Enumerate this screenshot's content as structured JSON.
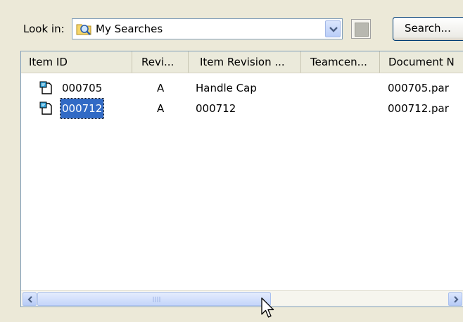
{
  "toolbar": {
    "lookin_label": "Look in:",
    "combo_value": "My Searches",
    "search_label": "Search..."
  },
  "list": {
    "columns": [
      "Item ID",
      "Revi...",
      "Item Revision ...",
      "Teamcen...",
      "Document N"
    ],
    "rows": [
      {
        "item_id": "000705",
        "revision": "A",
        "item_revision_name": "Handle Cap",
        "teamcenter": "",
        "document_name": "000705.par",
        "selected": false
      },
      {
        "item_id": "000712",
        "revision": "A",
        "item_revision_name": "000712",
        "teamcenter": "",
        "document_name": "000712.par",
        "selected": true
      }
    ]
  },
  "scrollbar": {
    "position": 0.0
  },
  "icons": {
    "folder": "search-folder-icon",
    "dropdown": "chevron-down-icon",
    "item": "item-document-icon",
    "scroll_left": "arrow-left-icon",
    "scroll_right": "arrow-right-icon",
    "cursor": "mouse-pointer-icon"
  },
  "colors": {
    "selection": "#316ac5",
    "frame": "#7f9db9",
    "background": "#ece9d8"
  }
}
